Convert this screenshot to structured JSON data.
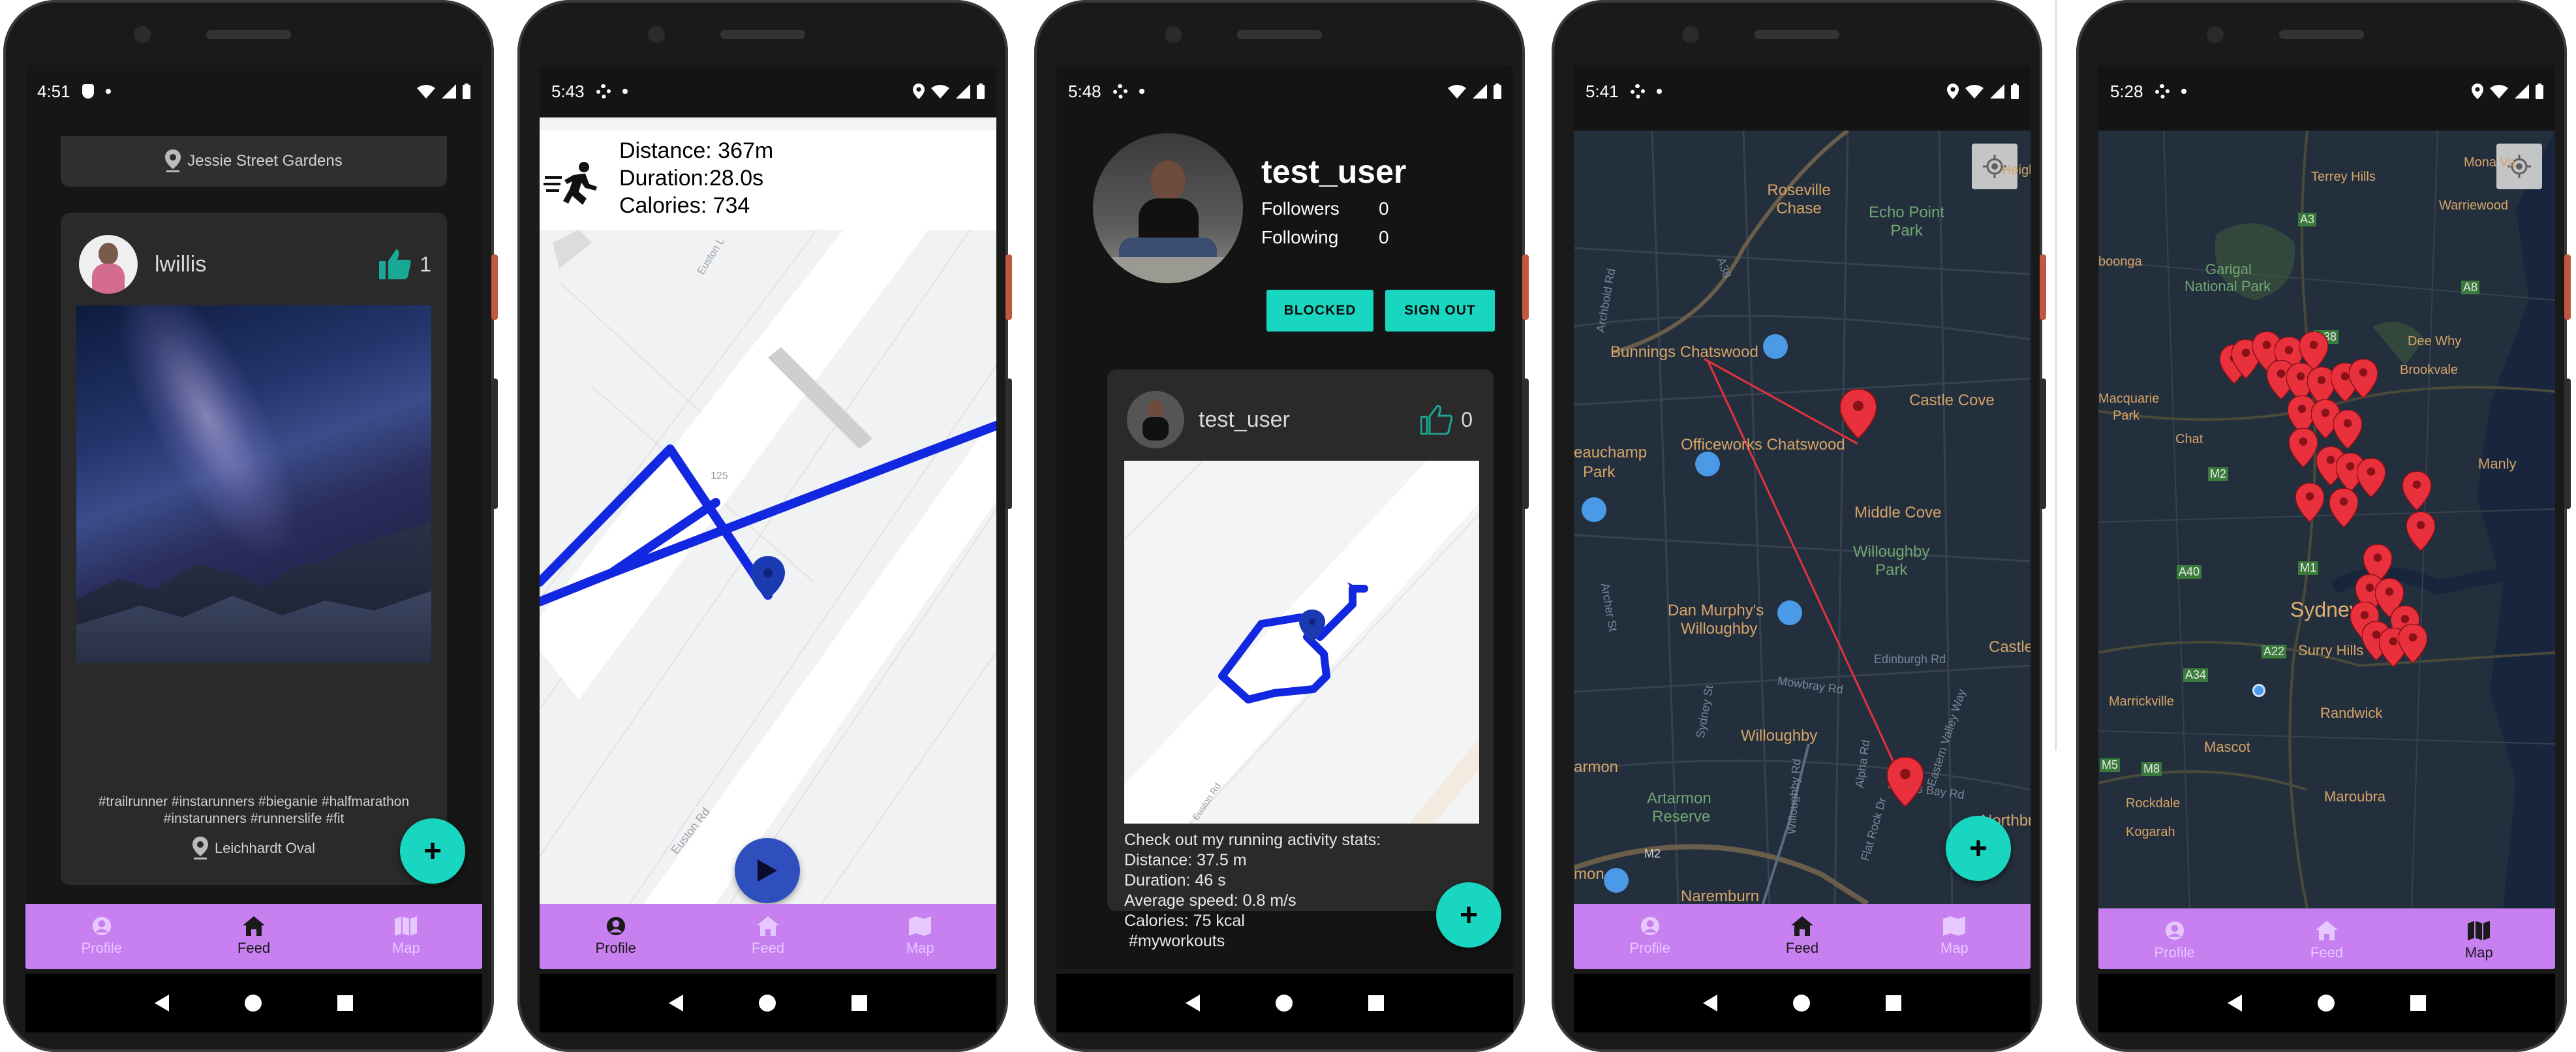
{
  "colors": {
    "accent": "#19d6c0",
    "nav_bg": "#c87ff0",
    "route_blue": "#1228e0",
    "marker_red": "#e8313c",
    "map_bg": "#242f3e"
  },
  "nav": {
    "profile": "Profile",
    "feed": "Feed",
    "map": "Map"
  },
  "screen1": {
    "time": "4:51",
    "top_location": "Jessie Street Gardens",
    "post": {
      "username": "lwillis",
      "likes": "1",
      "hashtags_line1": "#trailrunner #instarunners #bieganie #halfmarathon",
      "hashtags_line2": "#instarunners #runnerslife #fit",
      "location": "Leichhardt Oval"
    },
    "active_tab": "feed"
  },
  "screen2": {
    "time": "5:43",
    "distance": "Distance: 367m",
    "duration": "Duration:28.0s",
    "calories": "Calories: 734",
    "street1": "Euston L",
    "street2": "Euston Rd",
    "block_number": "125",
    "active_tab": "profile"
  },
  "screen3": {
    "time": "5:48",
    "username": "test_user",
    "followers_label": "Followers",
    "followers_count": "0",
    "following_label": "Following",
    "following_count": "0",
    "blocked_button": "BLOCKED",
    "signout_button": "SIGN OUT",
    "post": {
      "username": "test_user",
      "likes": "0",
      "street": "Euston Rd",
      "caption_line1": "Check out my running activity stats:",
      "caption_line2": "Distance: 37.5 m",
      "caption_line3": "Duration: 46 s",
      "caption_line4": "Average speed: 0.8 m/s",
      "caption_line5": "Calories: 75 kcal",
      "caption_line6": " #myworkouts"
    }
  },
  "screen4": {
    "time": "5:41",
    "labels": {
      "roseville_chase": "Roseville Chase",
      "echo_point": "Echo Point Park",
      "bunnings": "Bunnings Chatswood",
      "castle_cove": "Castle Cove",
      "officeworks": "Officeworks Chatswood",
      "beauchamp": "eauchamp",
      "beauchamp_park": "Park",
      "middle_cove": "Middle Cove",
      "willoughby_park1": "Willoughby",
      "willoughby_park2": "Park",
      "dan_murphys1": "Dan Murphy's",
      "dan_murphys2": "Willoughby",
      "castle": "Castle",
      "willoughby": "Willoughby",
      "armon": "armon",
      "artarmon_reserve1": "Artarmon",
      "artarmon_reserve2": "Reserve",
      "northbr": "Northbr",
      "mon": "mon",
      "naremburn": "Naremburn",
      "m2": "M2",
      "a38": "A38",
      "archbold": "Archbold Rd",
      "mowbray": "Mowbray Rd",
      "edinburgh": "Edinburgh Rd",
      "sailors_bay": "Sailors Bay Rd",
      "eastern_valley": "Eastern Valley Way",
      "alpha": "Alpha Rd",
      "flat_rock": "Flat Rock Dr",
      "willoughby_rd": "Willoughby Rd",
      "sydney_st": "Sydney St",
      "archer_st": "Archer St",
      "high_top": "Height"
    },
    "active_tab": "feed"
  },
  "screen5": {
    "time": "5:28",
    "labels": {
      "terrey_hills": "Terrey Hills",
      "mona_vale": "Mona Va",
      "warriewood": "Warriewood",
      "booga": "boonga",
      "garigal1": "Garigal",
      "garigal2": "National Park",
      "dee_why": "Dee Why",
      "brookvale": "Brookvale",
      "macquarie1": "Macquarie",
      "macquarie2": "Park",
      "chat": "Chat",
      "manly": "Manly",
      "sydney": "Sydney",
      "surry_hills": "Surry Hills",
      "marrickville": "Marrickville",
      "randwick": "Randwick",
      "mascot": "Mascot",
      "rockdale": "Rockdale",
      "kogarah": "Kogarah",
      "maroubra": "Maroubra",
      "a3": "A3",
      "a8": "A8",
      "a38": "A38",
      "m2": "M2",
      "a40": "A40",
      "m1": "M1",
      "a22": "A22",
      "a34": "A34",
      "m5": "M5",
      "m8": "M8"
    },
    "active_tab": "map"
  }
}
